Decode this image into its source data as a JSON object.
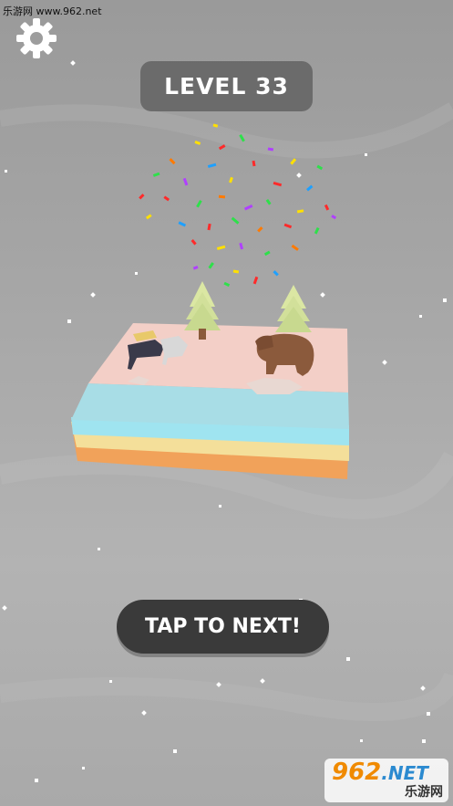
{
  "watermark": {
    "text": "乐游网 www.962.net"
  },
  "settings": {
    "icon": "gear-icon"
  },
  "level": {
    "label": "LEVEL 33"
  },
  "next_button": {
    "label": "TAP TO NEXT!"
  },
  "logo": {
    "main": "962",
    "net": ".NET",
    "sub": "乐游网"
  },
  "colors": {
    "island_top": "#f3cfc7",
    "water": "#a8dde6",
    "layer_cyan": "#9fe4f0",
    "layer_yellow": "#f4df9a",
    "layer_orange": "#f1a25a",
    "tree": "#dbe7a3",
    "bear": "#8b5a3c"
  }
}
